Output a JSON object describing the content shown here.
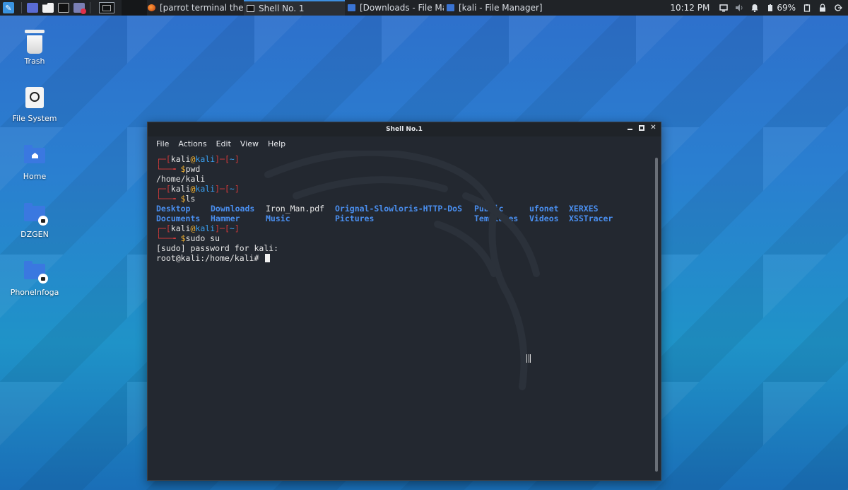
{
  "taskbar": {
    "tasks": [
      {
        "label": "[parrot terminal theme -...",
        "icon": "firefox-icon"
      },
      {
        "label": "Shell No. 1",
        "icon": "terminal-icon",
        "active": true
      },
      {
        "label": "[Downloads - File Mana...",
        "icon": "folder-icon"
      },
      {
        "label": "[kali - File Manager]",
        "icon": "folder-icon"
      }
    ],
    "clock": "10:12 PM",
    "battery": "69%"
  },
  "desktop": {
    "icons": [
      {
        "label": "Trash",
        "icon": "trash-icon"
      },
      {
        "label": "File System",
        "icon": "drive-icon"
      },
      {
        "label": "Home",
        "icon": "home-folder-icon"
      },
      {
        "label": "DZGEN",
        "icon": "locked-folder-icon"
      },
      {
        "label": "PhoneInfoga",
        "icon": "locked-folder-icon"
      }
    ]
  },
  "terminal": {
    "title": "Shell No.1",
    "menu": [
      "File",
      "Actions",
      "Edit",
      "View",
      "Help"
    ],
    "prompt_user": "kali",
    "prompt_host": "kali",
    "prompt_dir": "~",
    "commands": {
      "cmd1": "pwd",
      "out1": "/home/kali",
      "cmd2": "ls",
      "cmd3": "sudo su",
      "out3a": "[sudo] password for kali:",
      "out3b": "root@kali:/home/kali#"
    },
    "ls_rows": [
      [
        "Desktop",
        "Downloads",
        "Iron_Man.pdf",
        "Orignal-Slowloris-HTTP-DoS",
        "Public",
        "ufonet",
        "XERXES"
      ],
      [
        "Documents",
        "Hammer",
        "Music",
        "Pictures",
        "Templates",
        "Videos",
        "XSSTracer"
      ]
    ]
  },
  "colors": {
    "prompt_bracket": "#d23a3a",
    "prompt_host": "#3aa0f0",
    "prompt_dollar": "#f0b030",
    "directory": "#4a8ff0",
    "terminal_bg": "#232830"
  }
}
